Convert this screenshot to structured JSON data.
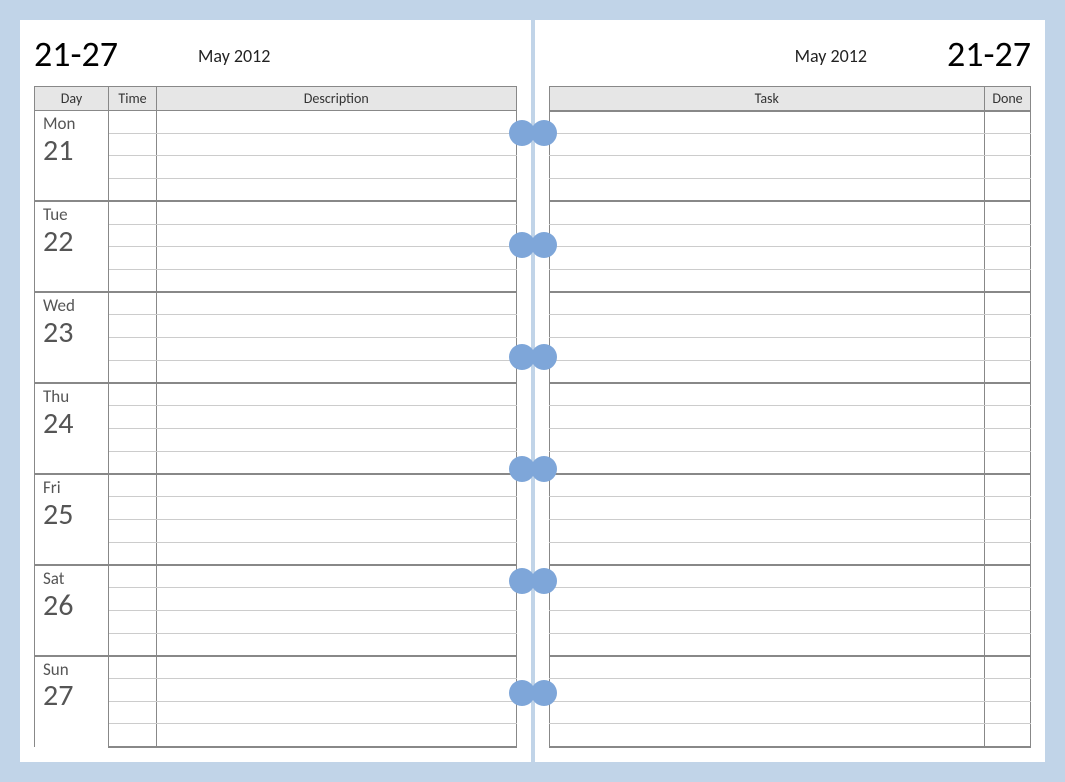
{
  "week_range": "21-27",
  "month_year": "May 2012",
  "left_columns": {
    "day": "Day",
    "time": "Time",
    "description": "Description"
  },
  "right_columns": {
    "task": "Task",
    "done": "Done"
  },
  "days": [
    {
      "name": "Mon",
      "num": "21"
    },
    {
      "name": "Tue",
      "num": "22"
    },
    {
      "name": "Wed",
      "num": "23"
    },
    {
      "name": "Thu",
      "num": "24"
    },
    {
      "name": "Fri",
      "num": "25"
    },
    {
      "name": "Sat",
      "num": "26"
    },
    {
      "name": "Sun",
      "num": "27"
    }
  ],
  "task_rows": 28,
  "task_group_size": 4,
  "binder_holes": 6,
  "colors": {
    "page_bg": "#ffffff",
    "outer_bg": "#c1d4e8",
    "hole": "#7ea6d9"
  }
}
